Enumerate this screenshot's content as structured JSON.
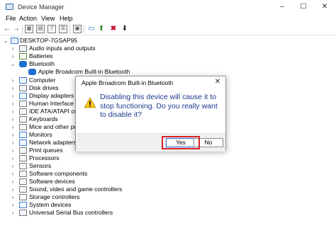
{
  "window": {
    "title": "Device Manager",
    "controls": [
      "–",
      "☐",
      "✕"
    ]
  },
  "menu": [
    "File",
    "Action",
    "View",
    "Help"
  ],
  "toolbar": [
    "back-icon",
    "forward-icon",
    "grid-icon",
    "help-icon",
    "properties-icon",
    "monitor-icon",
    "update-driver-icon",
    "uninstall-icon",
    "download-icon"
  ],
  "tree": {
    "root": "DESKTOP-7GSAP95",
    "items": [
      {
        "label": "Audio inputs and outputs",
        "icon": "speaker-icon",
        "color": "#6b6b6b"
      },
      {
        "label": "Batteries",
        "icon": "battery-icon",
        "color": "#5a8f3c"
      },
      {
        "label": "Bluetooth",
        "icon": "bluetooth-icon",
        "color": "#1f6fd0"
      },
      {
        "label": "Apple Broadcom Built-in Bluetooth",
        "icon": "bluetooth-icon",
        "color": "#1f6fd0"
      },
      {
        "label": "Computer",
        "icon": "computer-icon",
        "color": "#3a7bd5"
      },
      {
        "label": "Disk drives",
        "icon": "disk-icon",
        "color": "#777777"
      },
      {
        "label": "Display adapters",
        "icon": "display-icon",
        "color": "#3a7bd5"
      },
      {
        "label": "Human Interface Dev",
        "icon": "hid-icon",
        "color": "#777777"
      },
      {
        "label": "IDE ATA/ATAPI contro",
        "icon": "ide-icon",
        "color": "#777777"
      },
      {
        "label": "Keyboards",
        "icon": "keyboard-icon",
        "color": "#777777"
      },
      {
        "label": "Mice and other pointe",
        "icon": "mouse-icon",
        "color": "#777777"
      },
      {
        "label": "Monitors",
        "icon": "monitor-icon",
        "color": "#3a7bd5"
      },
      {
        "label": "Network adapters",
        "icon": "network-icon",
        "color": "#3a7bd5"
      },
      {
        "label": "Print queues",
        "icon": "printer-icon",
        "color": "#777777"
      },
      {
        "label": "Processors",
        "icon": "processor-icon",
        "color": "#777777"
      },
      {
        "label": "Sensors",
        "icon": "sensor-icon",
        "color": "#777777"
      },
      {
        "label": "Software components",
        "icon": "component-icon",
        "color": "#777777"
      },
      {
        "label": "Software devices",
        "icon": "software-icon",
        "color": "#777777"
      },
      {
        "label": "Sound, video and game controllers",
        "icon": "sound-icon",
        "color": "#777777"
      },
      {
        "label": "Storage controllers",
        "icon": "storage-icon",
        "color": "#777777"
      },
      {
        "label": "System devices",
        "icon": "system-icon",
        "color": "#3a7bd5"
      },
      {
        "label": "Universal Serial Bus controllers",
        "icon": "usb-icon",
        "color": "#777777"
      }
    ]
  },
  "dialog": {
    "title": "Apple Broadcom Built-in Bluetooth",
    "message": "Disabling this device will cause it to stop functioning. Do you really want to disable it?",
    "yes": "Yes",
    "no": "No",
    "highlight_color": "#d6212a"
  }
}
